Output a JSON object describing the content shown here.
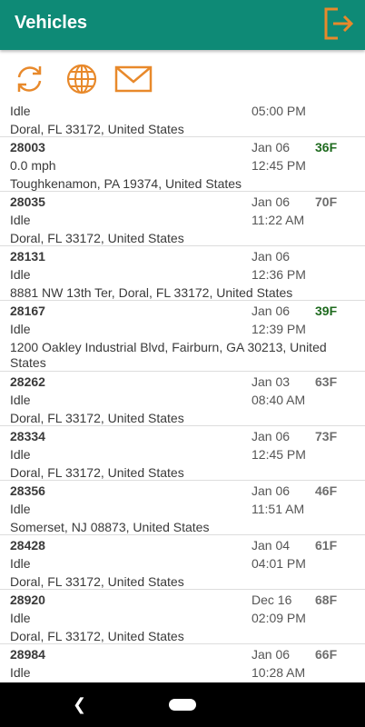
{
  "appbar": {
    "title": "Vehicles",
    "color": "#0e8a76",
    "logout_icon": "logout-icon"
  },
  "toolbar": {
    "icons": [
      "refresh-icon",
      "globe-icon",
      "mail-icon"
    ],
    "icon_color": "#e8892b"
  },
  "vehicles": [
    {
      "id": "",
      "status": "Idle",
      "address": "Doral, FL 33172, United States",
      "date": "",
      "time": "05:00 PM",
      "temp": ""
    },
    {
      "id": "28003",
      "status": "0.0 mph",
      "address": "Toughkenamon, PA 19374, United States",
      "date": "Jan 06",
      "time": "12:45 PM",
      "temp": "36F"
    },
    {
      "id": "28035",
      "status": "Idle",
      "address": "Doral, FL 33172, United States",
      "date": "Jan 06",
      "time": "11:22 AM",
      "temp": "70F"
    },
    {
      "id": "28131",
      "status": "Idle",
      "address": "8881 NW 13th Ter, Doral, FL 33172, United States",
      "date": "Jan 06",
      "time": "12:36 PM",
      "temp": ""
    },
    {
      "id": "28167",
      "status": "Idle",
      "address": "1200 Oakley Industrial Blvd, Fairburn, GA 30213, United States",
      "date": "Jan 06",
      "time": "12:39 PM",
      "temp": "39F"
    },
    {
      "id": "28262",
      "status": "Idle",
      "address": "Doral, FL 33172, United States",
      "date": "Jan 03",
      "time": "08:40 AM",
      "temp": "63F"
    },
    {
      "id": "28334",
      "status": "Idle",
      "address": "Doral, FL 33172, United States",
      "date": "Jan 06",
      "time": "12:45 PM",
      "temp": "73F"
    },
    {
      "id": "28356",
      "status": "Idle",
      "address": "Somerset, NJ 08873, United States",
      "date": "Jan 06",
      "time": "11:51 AM",
      "temp": "46F"
    },
    {
      "id": "28428",
      "status": "Idle",
      "address": "Doral, FL 33172, United States",
      "date": "Jan 04",
      "time": "04:01 PM",
      "temp": "61F"
    },
    {
      "id": "28920",
      "status": "Idle",
      "address": "Doral, FL 33172, United States",
      "date": "Dec 16",
      "time": "02:09 PM",
      "temp": "68F"
    },
    {
      "id": "28984",
      "status": "Idle",
      "address": "",
      "date": "Jan 06",
      "time": "10:28 AM",
      "temp": "66F"
    }
  ],
  "temp_colors": {
    "cold": "#1f6b1f",
    "normal": "#6e6e6e"
  },
  "navbar": {
    "back_icon": "back-icon",
    "home_icon": "home-pill-icon"
  }
}
